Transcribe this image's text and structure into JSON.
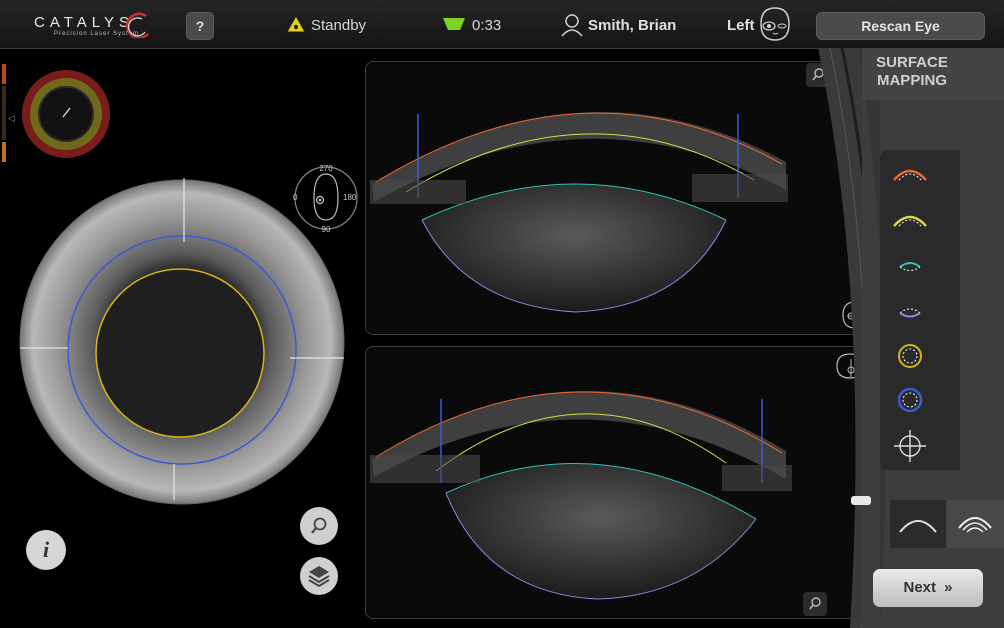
{
  "header": {
    "logo_text": "CATALYS",
    "logo_subtitle": "Precision Laser System",
    "help_label": "?",
    "status_text": "Standby",
    "timer_text": "0:33",
    "patient_name": "Smith, Brian",
    "eye_side": "Left",
    "rescan_label": "Rescan Eye"
  },
  "orientation_dial": {
    "top": "270",
    "left": "0",
    "right": "180",
    "bottom": "90"
  },
  "left_panel": {
    "info_label": "i",
    "zoom_icon": "zoom-icon",
    "layers_icon": "layers-icon"
  },
  "sidebar": {
    "title_line1": "SURFACE",
    "title_line2": "MAPPING",
    "tools": [
      "anterior-cornea-icon",
      "posterior-cornea-icon",
      "anterior-lens-icon",
      "posterior-lens-icon",
      "pupil-ring-icon",
      "limbus-ring-icon",
      "crosshair-target-icon"
    ],
    "next_label": "Next"
  },
  "colors": {
    "orange_surface": "#e8692e",
    "yellow_surface": "#d8d84a",
    "cyan_surface": "#2fc1b3",
    "purple_surface": "#9b7fe0",
    "gold_ring": "#d8b41a",
    "blue_ring": "#3d5ad6",
    "button_gray": "#4b4b4b"
  }
}
